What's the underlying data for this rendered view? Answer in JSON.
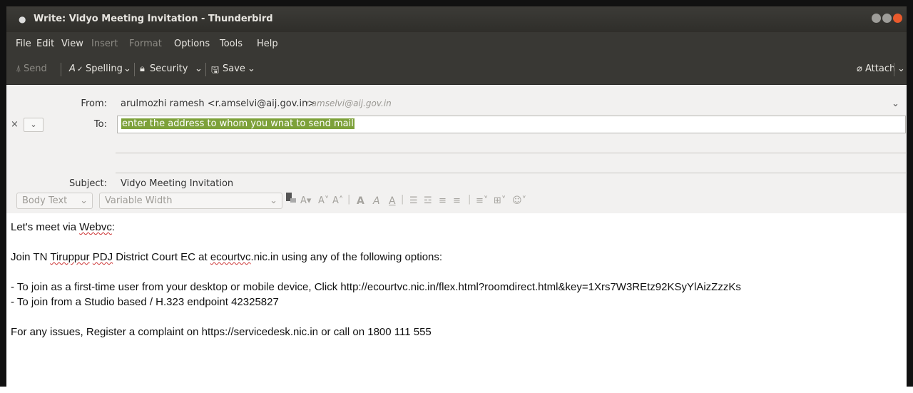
{
  "window": {
    "title": "Write: Vidyo Meeting Invitation - Thunderbird",
    "controls": {
      "min": "#9e9d99",
      "max": "#9e9d99",
      "close": "#ea5a2c"
    }
  },
  "menu": {
    "file": "File",
    "edit": "Edit",
    "view": "View",
    "insert": "Insert",
    "format": "Format",
    "options": "Options",
    "tools": "Tools",
    "help": "Help"
  },
  "toolbar": {
    "send": "Send",
    "spelling": "Spelling",
    "security": "Security",
    "save": "Save",
    "attach": "Attach"
  },
  "header": {
    "from_label": "From:",
    "from_value": "arulmozhi ramesh <r.amselvi@aij.gov.in>",
    "from_identity": "r.amselvi@aij.gov.in",
    "to_label": "To:",
    "to_value": "enter the address to whom you wnat to send mail",
    "subject_label": "Subject:",
    "subject_value": "Vidyo Meeting Invitation"
  },
  "format_bar": {
    "paragraph": "Body Text",
    "font": "Variable Width",
    "icons": {
      "text_size": "A▾",
      "smaller": "A˅",
      "larger": "A˄",
      "bold": "A",
      "italic": "A",
      "underline": "A",
      "bullets": "☰",
      "numbered": "☲",
      "outdent": "≡",
      "indent": "≡",
      "align": "≡˅",
      "insert": "⊞˅",
      "smiley": "☺˅"
    }
  },
  "body": {
    "greeting_pre": "Let's meet via ",
    "greeting_word": "Webvc",
    "greeting_post": ":",
    "join_pre": "Join TN ",
    "join_w1": "Tiruppur",
    "join_mid1": " ",
    "join_w2": "PDJ",
    "join_mid2": " District Court EC at ",
    "join_w3": "ecourtvc",
    "join_post": ".nic.in using any of the following options:",
    "opt1": "- To join as a first-time user from your desktop or mobile device, Click http://ecourtvc.nic.in/flex.html?roomdirect.html&key=1Xrs7W3REtz92KSyYlAizZzzKs",
    "opt2": "- To join from a Studio based / H.323 endpoint 42325827",
    "support": "For any issues, Register a complaint on https://servicedesk.nic.in or call on 1800 111 555"
  }
}
